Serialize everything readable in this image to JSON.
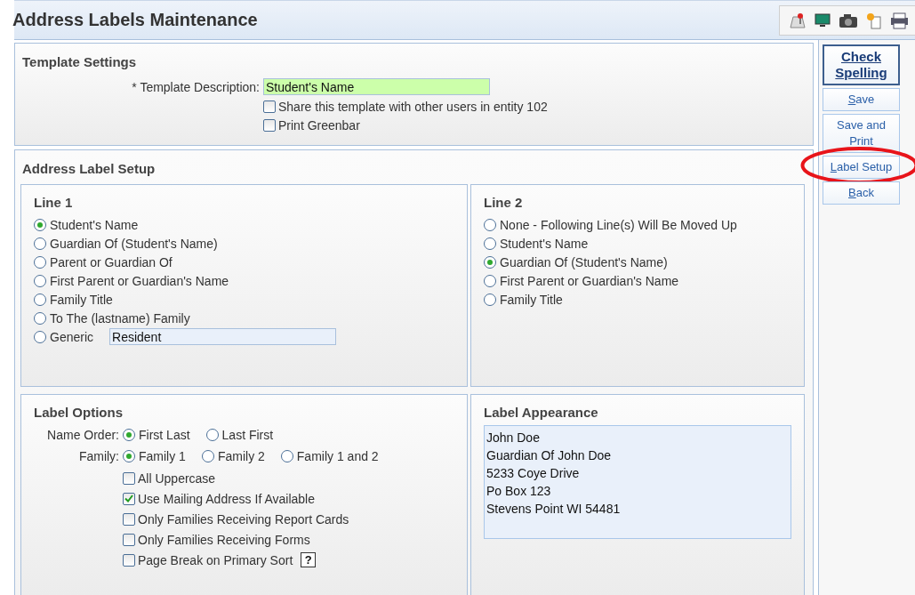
{
  "header": {
    "title": "Address Labels Maintenance"
  },
  "template_settings": {
    "title": "Template Settings",
    "description_label": "* Template Description:",
    "description_value": "Student's Name",
    "options": [
      {
        "label": "Share this template with other users in entity 102",
        "checked": false
      },
      {
        "label": "Print Greenbar",
        "checked": false
      }
    ]
  },
  "address_label_setup": {
    "title": "Address Label Setup",
    "line_1": {
      "title": "Line 1",
      "options": [
        {
          "label": "Student's Name",
          "selected": true
        },
        {
          "label": "Guardian Of (Student's Name)",
          "selected": false
        },
        {
          "label": "Parent or Guardian Of",
          "selected": false
        },
        {
          "label": "First Parent or Guardian's Name",
          "selected": false
        },
        {
          "label": "Family Title",
          "selected": false
        },
        {
          "label": "To The (lastname) Family",
          "selected": false
        },
        {
          "label": "Generic",
          "selected": false,
          "value": "Resident"
        }
      ]
    },
    "line_2": {
      "title": "Line 2",
      "options": [
        {
          "label": "None - Following Line(s) Will Be Moved Up",
          "selected": false
        },
        {
          "label": "Student's Name",
          "selected": false
        },
        {
          "label": "Guardian Of (Student's Name)",
          "selected": true
        },
        {
          "label": "First Parent or Guardian's Name",
          "selected": false
        },
        {
          "label": "Family Title",
          "selected": false
        }
      ]
    },
    "label_options": {
      "title": "Label Options",
      "groups": [
        {
          "label": "Name Order:",
          "options": [
            {
              "label": "First Last",
              "selected": true
            },
            {
              "label": "Last First",
              "selected": false
            }
          ]
        },
        {
          "label": "Family:",
          "options": [
            {
              "label": "Family 1",
              "selected": true
            },
            {
              "label": "Family 2",
              "selected": false
            },
            {
              "label": "Family 1 and 2",
              "selected": false
            }
          ]
        }
      ],
      "checkboxes": [
        {
          "label": "All Uppercase",
          "checked": false
        },
        {
          "label": "Use Mailing Address If Available",
          "checked": true
        },
        {
          "label": "Only Families Receiving Report Cards",
          "checked": false
        },
        {
          "label": "Only Families Receiving Forms",
          "checked": false
        },
        {
          "label": "Page Break on Primary Sort",
          "checked": false,
          "help": "?"
        }
      ]
    },
    "label_appearance": {
      "title": "Label Appearance",
      "lines": [
        "John Doe",
        "Guardian Of John Doe",
        "5233 Coye Drive",
        "Po Box 123",
        "Stevens Point WI 54481"
      ]
    }
  },
  "actions": [
    {
      "label": "Check Spelling",
      "kind": "primary",
      "circled": false
    },
    {
      "label": "Save",
      "kind": "normal",
      "hotkey_underlined": true,
      "circled": false
    },
    {
      "label": "Save and Print",
      "kind": "normal",
      "hotkey_underlined": false,
      "circled": false
    },
    {
      "label": "Label Setup",
      "kind": "normal",
      "hotkey_underlined": true,
      "circled": true
    },
    {
      "label": "Back",
      "kind": "normal",
      "hotkey_underlined": true,
      "circled": false
    }
  ]
}
